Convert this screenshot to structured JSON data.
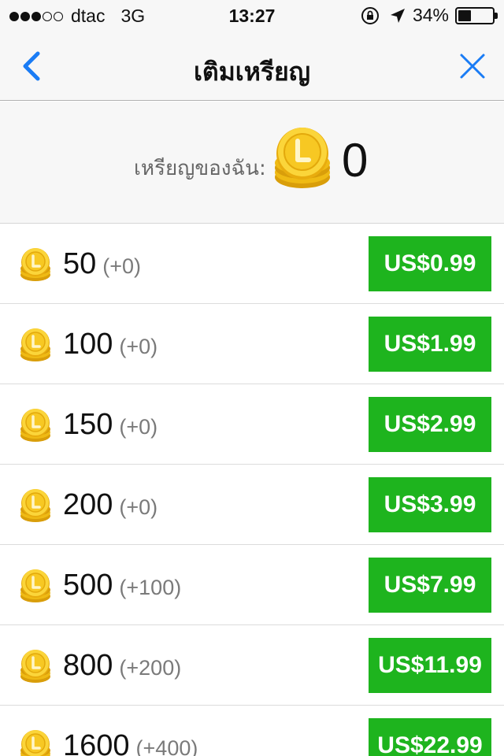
{
  "status_bar": {
    "carrier": "dtac",
    "network": "3G",
    "time": "13:27",
    "battery_percent_label": "34%",
    "battery_level": 0.34,
    "signal_bars": 3,
    "signal_total": 5
  },
  "nav": {
    "title": "เติมเหรียญ",
    "back_icon": "chevron-left-icon",
    "close_icon": "close-icon",
    "accent_color": "#1a7cf5"
  },
  "balance": {
    "label": "เหรียญของฉัน:",
    "value": "0"
  },
  "packages": [
    {
      "amount": "50",
      "bonus": "(+0)",
      "price": "US$0.99"
    },
    {
      "amount": "100",
      "bonus": "(+0)",
      "price": "US$1.99"
    },
    {
      "amount": "150",
      "bonus": "(+0)",
      "price": "US$2.99"
    },
    {
      "amount": "200",
      "bonus": "(+0)",
      "price": "US$3.99"
    },
    {
      "amount": "500",
      "bonus": "(+100)",
      "price": "US$7.99"
    },
    {
      "amount": "800",
      "bonus": "(+200)",
      "price": "US$11.99"
    },
    {
      "amount": "1600",
      "bonus": "(+400)",
      "price": "US$22.99"
    }
  ],
  "colors": {
    "buy_button": "#1eb41e",
    "coin": "#f2c61a"
  }
}
